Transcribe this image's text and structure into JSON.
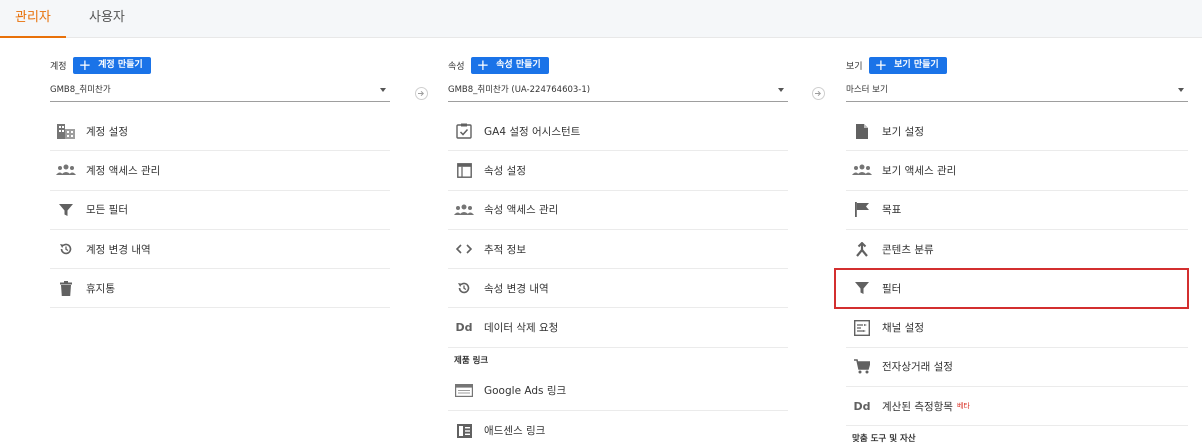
{
  "tabs": [
    {
      "label": "관리자",
      "active": true
    },
    {
      "label": "사용자",
      "active": false
    }
  ],
  "columns": {
    "account": {
      "label": "계정",
      "create_label": "계정 만들기",
      "selected": "GMB8_취미찬가",
      "items": [
        {
          "icon": "building-icon",
          "label": "계정 설정"
        },
        {
          "icon": "people-icon",
          "label": "계정 액세스 관리"
        },
        {
          "icon": "filter-icon",
          "label": "모든 필터"
        },
        {
          "icon": "history-icon",
          "label": "계정 변경 내역"
        },
        {
          "icon": "trash-icon",
          "label": "휴지통"
        }
      ]
    },
    "property": {
      "label": "속성",
      "create_label": "속성 만들기",
      "selected": "GMB8_취미찬가 (UA-224764603-1)",
      "items": [
        {
          "icon": "checklist-icon",
          "label": "GA4 설정 어시스턴트"
        },
        {
          "icon": "window-icon",
          "label": "속성 설정"
        },
        {
          "icon": "people-icon",
          "label": "속성 액세스 관리"
        },
        {
          "icon": "code-icon",
          "label": "추적 정보"
        },
        {
          "icon": "history-icon",
          "label": "속성 변경 내역"
        },
        {
          "icon": "data-deletion-icon",
          "icon_text": "Dd",
          "label": "데이터 삭제 요청"
        }
      ],
      "section_title": "제품 링크",
      "links": [
        {
          "icon": "google-ads-icon",
          "label": "Google Ads 링크"
        },
        {
          "icon": "adsense-icon",
          "label": "애드센스 링크"
        }
      ]
    },
    "view": {
      "label": "보기",
      "create_label": "보기 만들기",
      "selected": "마스터 보기",
      "items": [
        {
          "icon": "document-icon",
          "label": "보기 설정"
        },
        {
          "icon": "people-icon",
          "label": "보기 액세스 관리"
        },
        {
          "icon": "flag-icon",
          "label": "목표"
        },
        {
          "icon": "grouping-icon",
          "label": "콘텐츠 분류"
        },
        {
          "icon": "filter-icon",
          "label": "필터",
          "highlighted": true
        },
        {
          "icon": "channel-icon",
          "label": "채널 설정"
        },
        {
          "icon": "cart-icon",
          "label": "전자상거래 설정"
        },
        {
          "icon": "calculated-metric-icon",
          "icon_text": "Dd",
          "label": "계산된 측정항목",
          "badge": "베타"
        }
      ],
      "section_title": "맞춤 도구 및 자산"
    }
  },
  "colors": {
    "accent": "#e8710a",
    "primary": "#1a73e8",
    "highlight": "#d32f2f"
  }
}
